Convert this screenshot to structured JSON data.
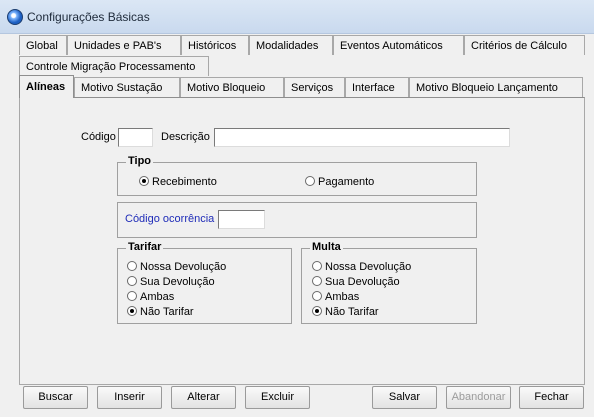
{
  "window": {
    "title": "Configurações Básicas"
  },
  "tabs_row1": [
    {
      "label": "Global"
    },
    {
      "label": "Unidades e PAB's"
    },
    {
      "label": "Históricos"
    },
    {
      "label": "Modalidades"
    },
    {
      "label": "Eventos Automáticos"
    },
    {
      "label": "Critérios de Cálculo"
    }
  ],
  "tabs_row2": [
    {
      "label": "Controle Migração Processamento"
    }
  ],
  "tabs_row3": [
    {
      "label": "Alíneas",
      "active": true
    },
    {
      "label": "Motivo Sustação"
    },
    {
      "label": "Motivo Bloqueio"
    },
    {
      "label": "Serviços"
    },
    {
      "label": "Interface"
    },
    {
      "label": "Motivo Bloqueio Lançamento"
    }
  ],
  "form": {
    "codigo_label": "Código",
    "codigo_value": "",
    "descricao_label": "Descrição",
    "descricao_value": "",
    "tipo": {
      "title": "Tipo",
      "options": [
        "Recebimento",
        "Pagamento"
      ],
      "selected": "Recebimento"
    },
    "codigo_ocorrencia_label": "Código ocorrência",
    "codigo_ocorrencia_value": "",
    "tarifar": {
      "title": "Tarifar",
      "options": [
        "Nossa Devolução",
        "Sua Devolução",
        "Ambas",
        "Não Tarifar"
      ],
      "selected": "Não Tarifar"
    },
    "multa": {
      "title": "Multa",
      "options": [
        "Nossa Devolução",
        "Sua Devolução",
        "Ambas",
        "Não Tarifar"
      ],
      "selected": "Não Tarifar"
    }
  },
  "buttons": {
    "buscar": "Buscar",
    "inserir": "Inserir",
    "alterar": "Alterar",
    "excluir": "Excluir",
    "salvar": "Salvar",
    "abandonar": "Abandonar",
    "fechar": "Fechar"
  }
}
